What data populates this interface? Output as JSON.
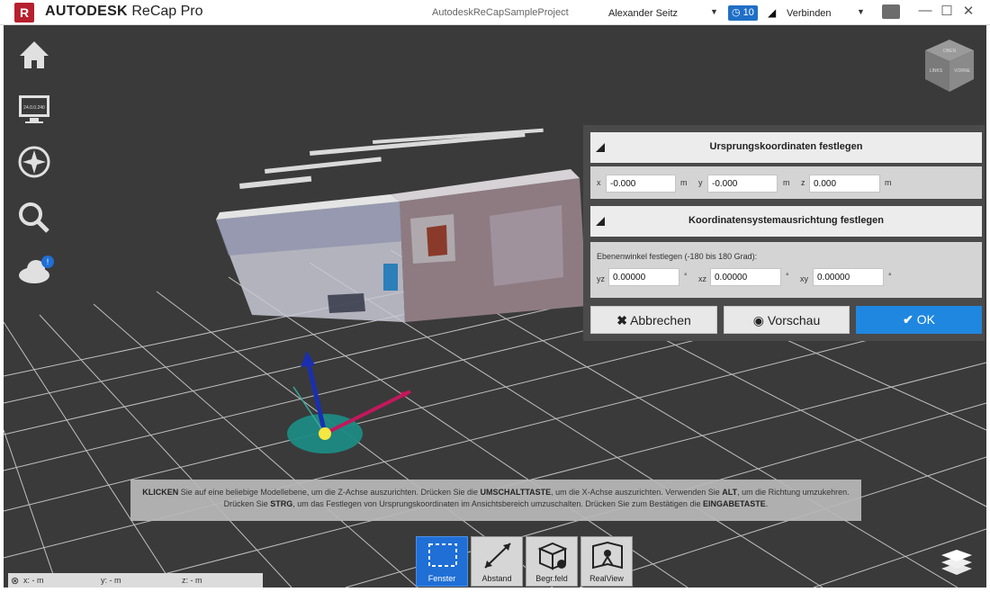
{
  "titlebar": {
    "brand": "AUTODESK",
    "product": "ReCap Pro",
    "project": "AutodeskReCapSampleProject",
    "user": "Alexander Seitz",
    "notifications": "10",
    "connect": "Verbinden"
  },
  "left_tools": [
    "home-icon",
    "monitor-icon",
    "compass-icon",
    "search-icon",
    "cloud-icon"
  ],
  "monitor_badge": "24.0.0.240",
  "viewcube": {
    "top": "OBEN",
    "left_face": "LINKS",
    "right_face": "VORNE"
  },
  "panel": {
    "origin": {
      "title": "Ursprungskoordinaten festlegen",
      "x_label": "x",
      "x_value": "-0.000",
      "y_label": "y",
      "y_value": "-0.000",
      "z_label": "z",
      "z_value": "0.000",
      "unit": "m"
    },
    "orientation": {
      "title": "Koordinatensystemausrichtung festlegen",
      "hint": "Ebenenwinkel festlegen (-180 bis 180 Grad):",
      "yz_label": "yz",
      "yz_value": "0.00000",
      "xz_label": "xz",
      "xz_value": "0.00000",
      "xy_label": "xy",
      "xy_value": "0.00000",
      "unit": "°"
    },
    "buttons": {
      "cancel": "Abbrechen",
      "preview": "Vorschau",
      "ok": "OK"
    }
  },
  "hint": {
    "l1_b1": "KLICKEN",
    "l1_t1": " Sie auf eine beliebige Modellebene, um die Z-Achse auszurichten. Drücken Sie die ",
    "l1_b2": "UMSCHALTTASTE",
    "l1_t2": ", um die X-Achse auszurichten. Verwenden Sie ",
    "l1_b3": "ALT",
    "l1_t3": ", um die Richtung umzukehren.",
    "l2_t1": "Drücken Sie ",
    "l2_b1": "STRG",
    "l2_t2": ", um das Festlegen von Ursprungskoordinaten im Ansichtsbereich umzuschalten. Drücken Sie zum Bestätigen die ",
    "l2_b2": "EINGABETASTE",
    "l2_t3": "."
  },
  "bottom_tools": [
    {
      "label": "Fenster",
      "active": true
    },
    {
      "label": "Abstand",
      "active": false
    },
    {
      "label": "Begr.feld",
      "active": false
    },
    {
      "label": "RealView",
      "active": false
    }
  ],
  "status": {
    "x": "x:  - m",
    "y": "y:  - m",
    "z": "z:  - m"
  },
  "colors": {
    "accent": "#1f87e0",
    "brand": "#b7202e",
    "viewport": "#3a3a3a"
  }
}
